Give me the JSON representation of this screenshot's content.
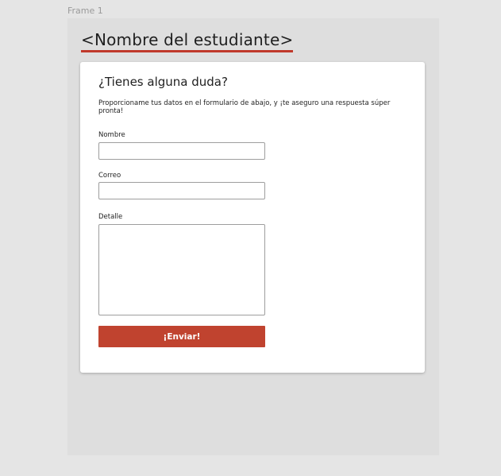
{
  "canvas": {
    "frame_label": "Frame 1"
  },
  "page": {
    "student_title": "<Nombre del estudiante>"
  },
  "form": {
    "title": "¿Tienes alguna duda?",
    "description": "Proporcioname tus datos en el formulario de abajo, y ¡te aseguro una respuesta súper pronta!",
    "fields": {
      "name": {
        "label": "Nombre",
        "value": "",
        "placeholder": ""
      },
      "email": {
        "label": "Correo",
        "value": "",
        "placeholder": ""
      },
      "detail": {
        "label": "Detalle",
        "value": "",
        "placeholder": ""
      }
    },
    "submit_label": "¡Enviar!"
  },
  "colors": {
    "accent": "#c0432f",
    "canvas_bg": "#e5e5e5",
    "frame_bg": "#dedede",
    "card_bg": "#ffffff"
  }
}
